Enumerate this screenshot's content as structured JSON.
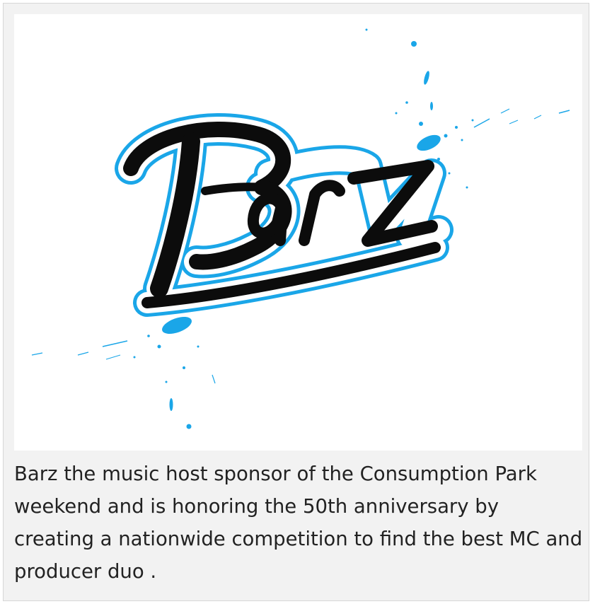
{
  "card": {
    "logo": {
      "text": "Barz",
      "colors": {
        "ink": "#0c0c0c",
        "outline": "#1aa6e8",
        "splash": "#1aa6e8"
      }
    },
    "caption": "Barz the music host sponsor of the Consumption Park weekend and is honoring the 50th anniversary by creating a nationwide competition to find the best MC and producer duo ."
  }
}
